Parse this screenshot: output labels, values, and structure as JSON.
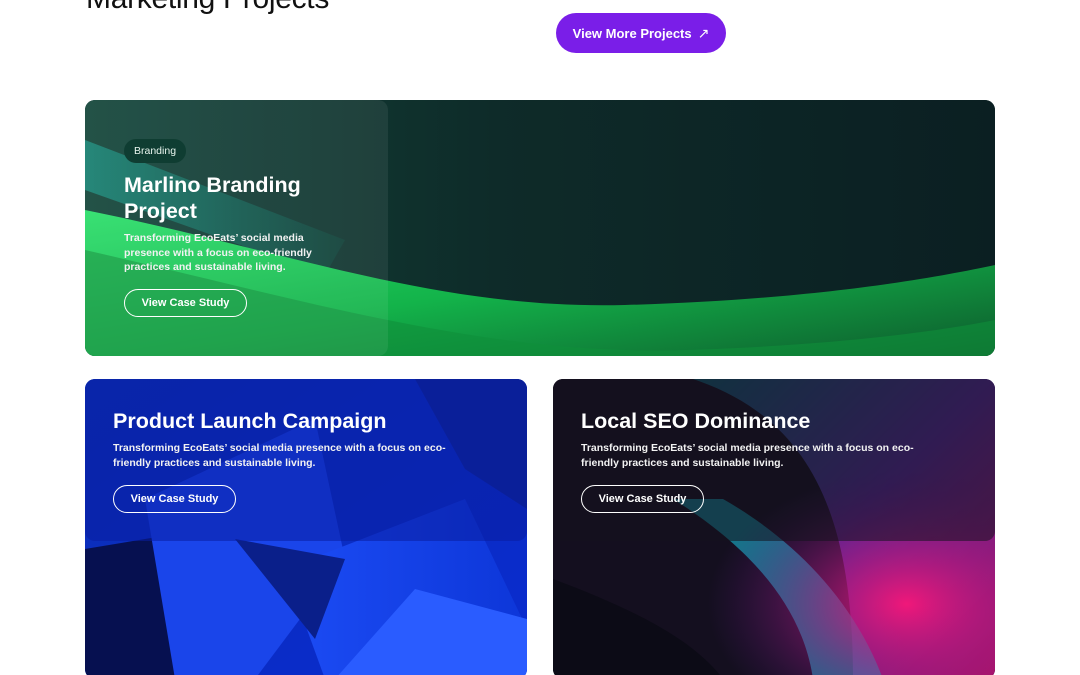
{
  "section": {
    "title": "Marketing Projects",
    "more_button_label": "View More Projects",
    "more_button_icon": "arrow-up-right-icon",
    "accent_color": "#7a1ee8"
  },
  "projects": [
    {
      "badge": "Branding",
      "title": "Marlino Branding Project",
      "description": "Transforming EcoEats’ social media presence with a focus on eco-friendly practices and sustainable living.",
      "button_label": "View Case Study",
      "theme_color": "#1ec45a"
    },
    {
      "title": "Product Launch Campaign",
      "description": "Transforming EcoEats’ social media presence with a focus on eco-friendly practices and sustainable living.",
      "button_label": "View Case Study",
      "theme_color": "#1a45f0"
    },
    {
      "title": "Local SEO Dominance",
      "description": "Transforming EcoEats’ social media presence with a focus on eco-friendly practices and sustainable living.",
      "button_label": "View Case Study",
      "theme_color": "#e0157a"
    }
  ]
}
